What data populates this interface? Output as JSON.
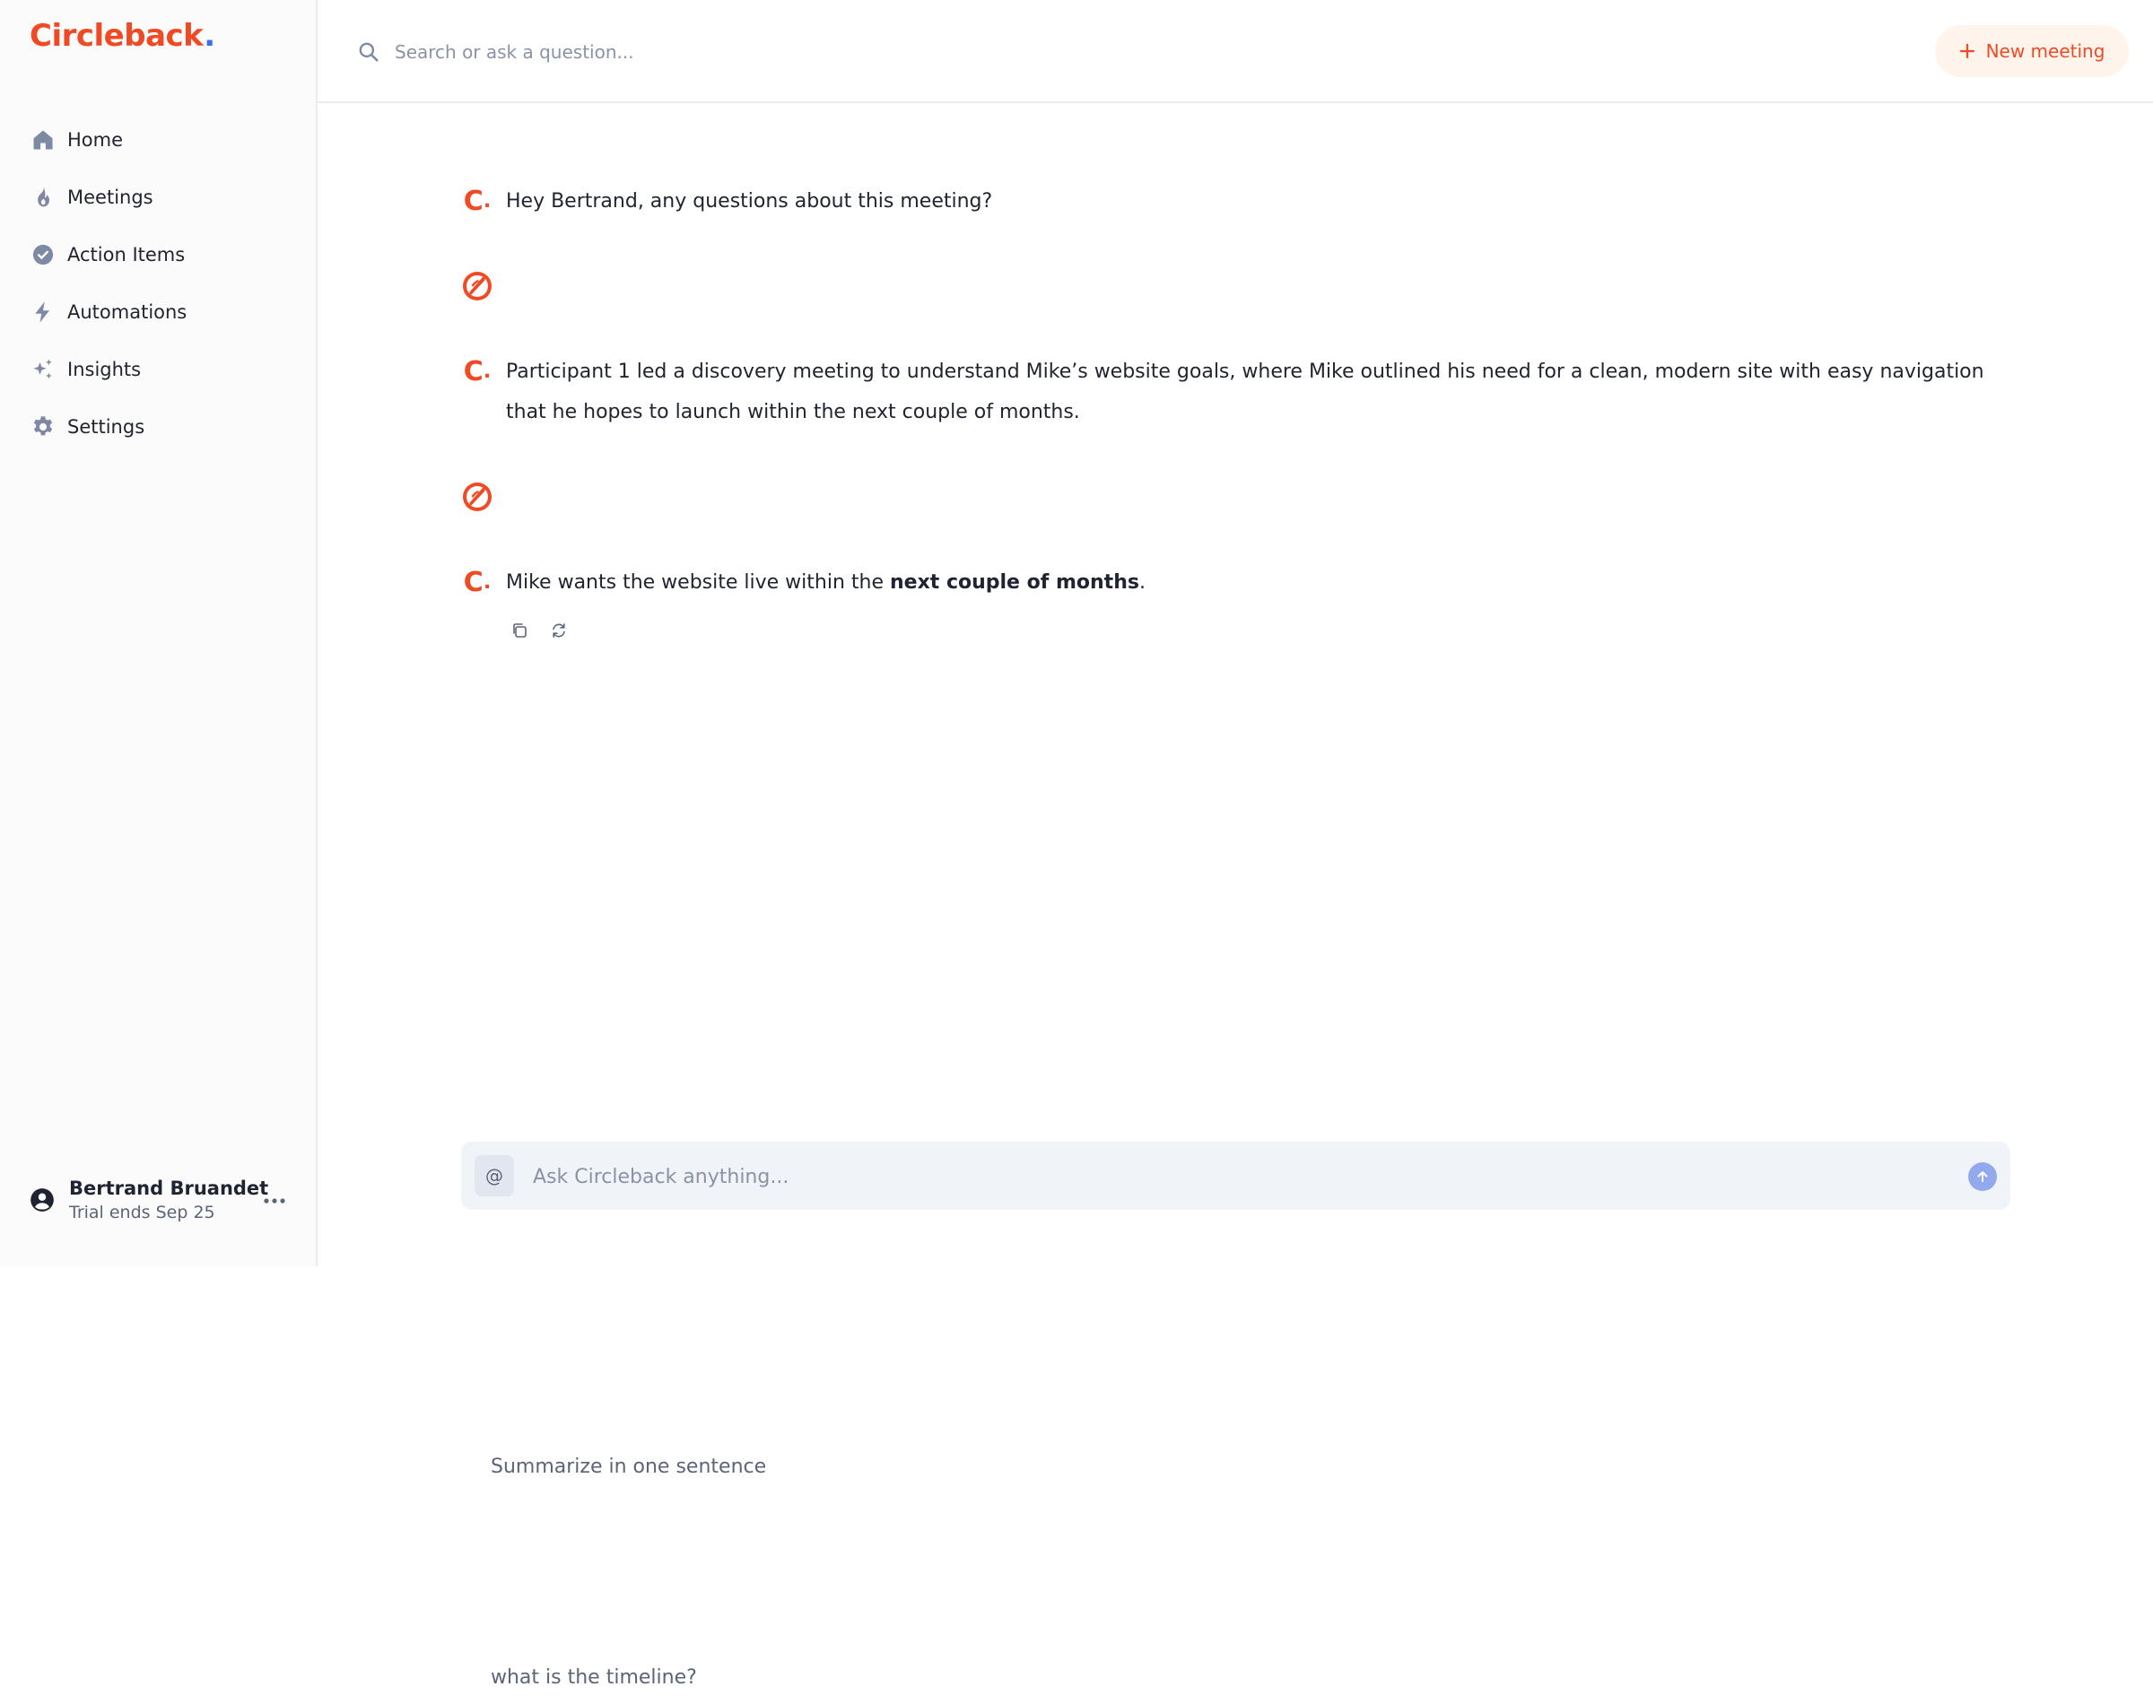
{
  "brand": {
    "name": "Circleback",
    "dot": ".",
    "accent": "#ef4a23",
    "dot_color": "#3b6df0"
  },
  "sidebar": {
    "items": [
      {
        "label": "Home",
        "icon": "home-icon"
      },
      {
        "label": "Meetings",
        "icon": "flame-icon"
      },
      {
        "label": "Action Items",
        "icon": "check-circle-icon"
      },
      {
        "label": "Automations",
        "icon": "bolt-icon"
      },
      {
        "label": "Insights",
        "icon": "sparkles-icon"
      },
      {
        "label": "Settings",
        "icon": "gear-icon"
      }
    ],
    "user": {
      "name": "Bertrand Bruandet",
      "trial": "Trial ends Sep 25"
    }
  },
  "topbar": {
    "search_placeholder": "Search or ask a question...",
    "new_meeting_label": "New meeting"
  },
  "chat": {
    "bot_badge": "C",
    "messages": [
      {
        "role": "assistant",
        "text": "Hey Bertrand, any questions about this meeting?"
      },
      {
        "role": "user",
        "text": "Summarize in one sentence"
      },
      {
        "role": "assistant",
        "text": "Participant 1 led a discovery meeting to understand Mike’s website goals, where Mike outlined his need for a clean, modern site with easy navigation that he hopes to launch within the next couple of months."
      },
      {
        "role": "user",
        "text": "what is the timeline?"
      },
      {
        "role": "assistant",
        "text_before": "Mike wants the website live within the ",
        "text_bold": "next couple of months",
        "text_after": "."
      }
    ]
  },
  "composer": {
    "at_label": "@",
    "placeholder": "Ask Circleback anything..."
  }
}
